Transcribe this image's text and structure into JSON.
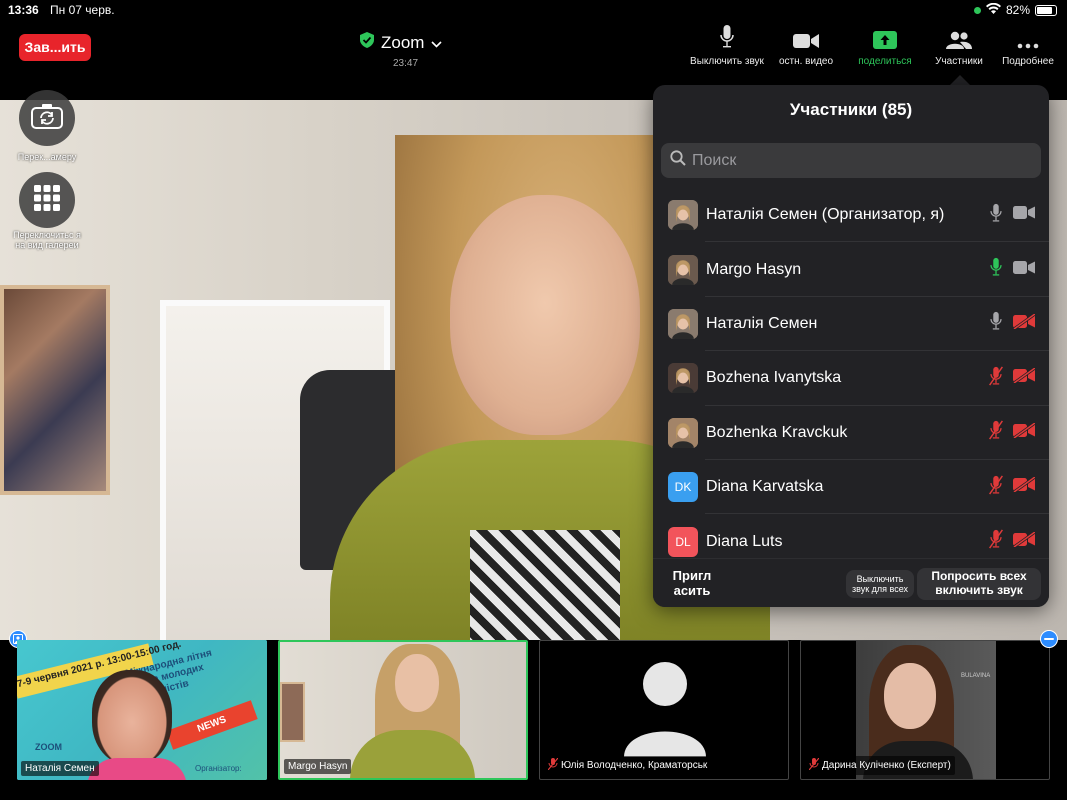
{
  "statusbar": {
    "time": "13:36",
    "date": "Пн 07 черв.",
    "battery": "82%",
    "battery_level": 0.82
  },
  "toolbar": {
    "end_label": "Зав...ить",
    "meeting_title": "Zoom",
    "meeting_time": "23:47",
    "mute_label": "Выключить звук",
    "video_label": "остн. видео",
    "share_label": "поделиться",
    "participants_label": "Участники",
    "more_label": "Подробнее"
  },
  "left_controls": {
    "switch_camera_label": "Перек...амеру",
    "gallery_label": "Переключитьс я на вид галереи"
  },
  "participants_panel": {
    "title": "Участники (85)",
    "search_placeholder": "Поиск",
    "participants": [
      {
        "name": "Наталія Семен (Организатор, я)",
        "initials": "",
        "avatar_color": "#8a7b6e",
        "mic": "off-gray",
        "video": "on"
      },
      {
        "name": "Margo Hasyn",
        "initials": "",
        "avatar_color": "#6b5a4e",
        "mic": "speaking",
        "video": "on"
      },
      {
        "name": "Наталія Семен",
        "initials": "",
        "avatar_color": "#8a7b6e",
        "mic": "off-gray",
        "video": "muted"
      },
      {
        "name": "Bozhena Ivanytska",
        "initials": "",
        "avatar_color": "#4a3b36",
        "mic": "muted",
        "video": "muted"
      },
      {
        "name": "Bozhenka Kravckuk",
        "initials": "",
        "avatar_color": "#a38468",
        "mic": "muted",
        "video": "muted"
      },
      {
        "name": "Diana Karvatska",
        "initials": "DK",
        "avatar_color": "#3a9ff0",
        "mic": "muted",
        "video": "muted"
      },
      {
        "name": "Diana Luts",
        "initials": "DL",
        "avatar_color": "#f2545b",
        "mic": "muted",
        "video": "muted"
      }
    ],
    "invite_label": "Пригл асить",
    "mute_all_label": "Выключить звук для всех",
    "ask_unmute_label": "Попросить всех включить звук"
  },
  "thumbnails": [
    {
      "name": "Наталія Семен",
      "muted": false,
      "active": false,
      "banner_text": "7-9 червня 2021 р. 13:00-15:00 год.",
      "school_text": "Міжнародна літня школа молодих журналістів",
      "news_text": "NEWS",
      "zoom_text": "ZOOM",
      "org_text": "Організатор:"
    },
    {
      "name": "Margo Hasyn",
      "muted": false,
      "active": true
    },
    {
      "name": "Юлія Володченко, Краматорськ",
      "muted": true,
      "active": false
    },
    {
      "name": "Дарина Куліченко (Експерт)",
      "muted": true,
      "active": false,
      "brand_text": "BULAVINA"
    }
  ]
}
